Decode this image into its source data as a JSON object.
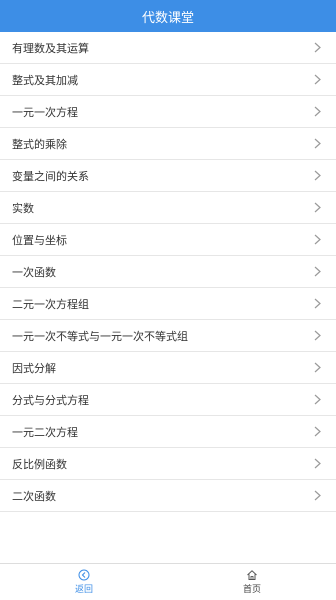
{
  "header": {
    "title": "代数课堂"
  },
  "list": {
    "items": [
      {
        "label": "有理数及其运算"
      },
      {
        "label": "整式及其加减"
      },
      {
        "label": "一元一次方程"
      },
      {
        "label": "整式的乘除"
      },
      {
        "label": "变量之间的关系"
      },
      {
        "label": "实数"
      },
      {
        "label": "位置与坐标"
      },
      {
        "label": "一次函数"
      },
      {
        "label": "二元一次方程组"
      },
      {
        "label": "一元一次不等式与一元一次不等式组"
      },
      {
        "label": "因式分解"
      },
      {
        "label": "分式与分式方程"
      },
      {
        "label": "一元二次方程"
      },
      {
        "label": "反比例函数"
      },
      {
        "label": "二次函数"
      }
    ]
  },
  "tabbar": {
    "back_label": "返回",
    "home_label": "首页"
  },
  "colors": {
    "accent": "#3d8ee6",
    "background": "#f2f2f2"
  },
  "icons": {
    "row_chevron": "chevron-right-icon",
    "back": "back-circle-icon",
    "home": "home-icon"
  }
}
